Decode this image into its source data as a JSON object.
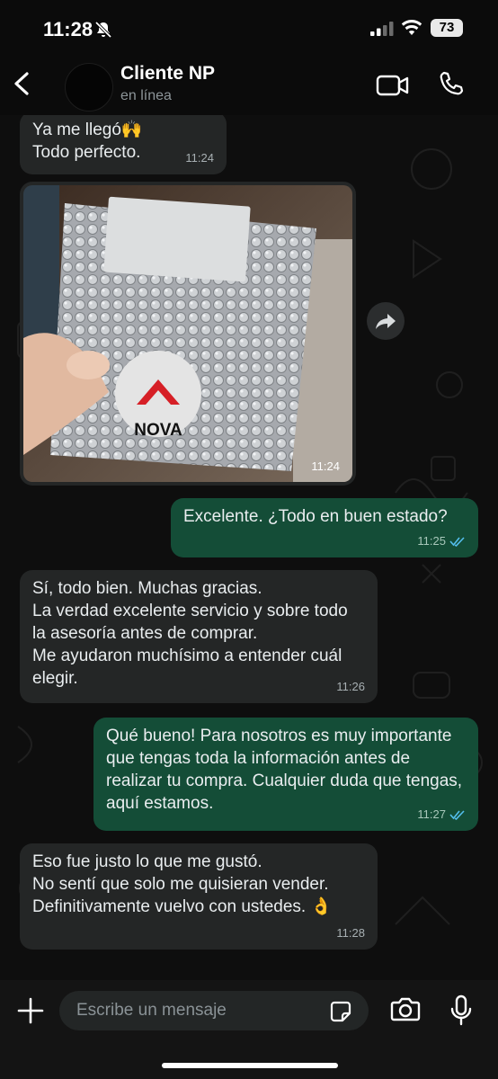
{
  "status_bar": {
    "time": "11:28",
    "battery": "73"
  },
  "header": {
    "contact_name": "Cliente NP",
    "status": "en línea"
  },
  "messages": [
    {
      "id": "m1",
      "direction": "in",
      "text": "Ya me llegó🙌\nTodo perfecto.",
      "time": "11:24"
    },
    {
      "id": "m2",
      "direction": "in",
      "type": "image",
      "logo_text": "NOVA",
      "time": "11:24"
    },
    {
      "id": "m3",
      "direction": "out",
      "text": "Excelente. ¿Todo en buen estado?",
      "time": "11:25",
      "read": true
    },
    {
      "id": "m4",
      "direction": "in",
      "text": "Sí, todo bien. Muchas gracias.\nLa verdad excelente servicio y sobre todo la asesoría antes de comprar.\nMe ayudaron muchísimo a entender cuál elegir.",
      "time": "11:26"
    },
    {
      "id": "m5",
      "direction": "out",
      "text": "Qué bueno! Para nosotros es muy importante que tengas toda la información antes de realizar tu compra. Cualquier duda que tengas, aquí estamos.",
      "time": "11:27",
      "read": true
    },
    {
      "id": "m6",
      "direction": "in",
      "text": "Eso fue justo lo que me gustó.\nNo sentí que solo me quisieran vender.\nDefinitivamente vuelvo con ustedes. 👌",
      "time": "11:28"
    }
  ],
  "composer": {
    "placeholder": "Escribe un mensaje"
  },
  "colors": {
    "incoming_bubble": "#242626",
    "outgoing_bubble": "#144d37",
    "read_ticks": "#53bdeb"
  },
  "icons": [
    "silent-bell-icon",
    "signal-icon",
    "wifi-icon",
    "back-arrow-icon",
    "video-call-icon",
    "phone-call-icon",
    "forward-icon",
    "read-ticks-icon",
    "plus-icon",
    "sticker-icon",
    "camera-icon",
    "mic-icon"
  ]
}
